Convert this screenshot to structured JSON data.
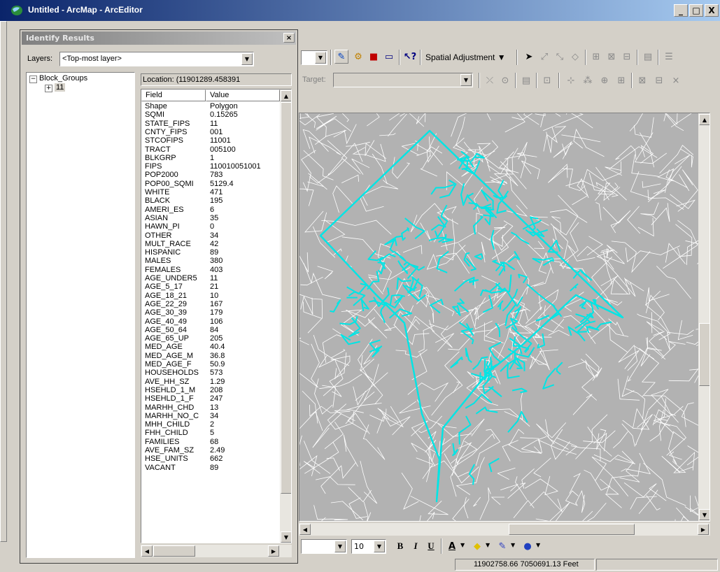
{
  "window": {
    "title": "Untitled - ArcMap - ArcEditor",
    "minimize": "_",
    "maximize": "□",
    "close": "X"
  },
  "toolbar": {
    "spatial_adjustment_label": "Spatial Adjustment ▼",
    "target_label": "Target:",
    "font_size": "10",
    "bold": "B",
    "italic": "I",
    "underline": "U",
    "font_color": "A"
  },
  "identify": {
    "title": "Identify Results",
    "close": "×",
    "layers_label": "Layers:",
    "layers_value": "<Top-most layer>",
    "tree": {
      "root_label": "Block_Groups",
      "child_label": "11"
    },
    "location": "Location: (11901289.458391",
    "columns": [
      "Field",
      "Value"
    ],
    "rows": [
      [
        "Shape",
        "Polygon"
      ],
      [
        "SQMI",
        "0.15265"
      ],
      [
        "STATE_FIPS",
        "11"
      ],
      [
        "CNTY_FIPS",
        "001"
      ],
      [
        "STCOFIPS",
        "11001"
      ],
      [
        "TRACT",
        "005100"
      ],
      [
        "BLKGRP",
        "1"
      ],
      [
        "FIPS",
        "110010051001"
      ],
      [
        "POP2000",
        "783"
      ],
      [
        "POP00_SQMI",
        "5129.4"
      ],
      [
        "WHITE",
        "471"
      ],
      [
        "BLACK",
        "195"
      ],
      [
        "AMERI_ES",
        "6"
      ],
      [
        "ASIAN",
        "35"
      ],
      [
        "HAWN_PI",
        "0"
      ],
      [
        "OTHER",
        "34"
      ],
      [
        "MULT_RACE",
        "42"
      ],
      [
        "HISPANIC",
        "89"
      ],
      [
        "MALES",
        "380"
      ],
      [
        "FEMALES",
        "403"
      ],
      [
        "AGE_UNDER5",
        "11"
      ],
      [
        "AGE_5_17",
        "21"
      ],
      [
        "AGE_18_21",
        "10"
      ],
      [
        "AGE_22_29",
        "167"
      ],
      [
        "AGE_30_39",
        "179"
      ],
      [
        "AGE_40_49",
        "106"
      ],
      [
        "AGE_50_64",
        "84"
      ],
      [
        "AGE_65_UP",
        "205"
      ],
      [
        "MED_AGE",
        "40.4"
      ],
      [
        "MED_AGE_M",
        "36.8"
      ],
      [
        "MED_AGE_F",
        "50.9"
      ],
      [
        "HOUSEHOLDS",
        "573"
      ],
      [
        "AVE_HH_SZ",
        "1.29"
      ],
      [
        "HSEHLD_1_M",
        "208"
      ],
      [
        "HSEHLD_1_F",
        "247"
      ],
      [
        "MARHH_CHD",
        "13"
      ],
      [
        "MARHH_NO_C",
        "34"
      ],
      [
        "MHH_CHILD",
        "2"
      ],
      [
        "FHH_CHILD",
        "5"
      ],
      [
        "FAMILIES",
        "68"
      ],
      [
        "AVE_FAM_SZ",
        "2.49"
      ],
      [
        "HSE_UNITS",
        "662"
      ],
      [
        "VACANT",
        "89"
      ]
    ]
  },
  "status": {
    "coordinates": "11902758.66  7050691.13 Feet"
  },
  "colors": {
    "title_active": "#0a246a",
    "highlight": "#00e5e5",
    "map_background": "#b2b2b2"
  }
}
